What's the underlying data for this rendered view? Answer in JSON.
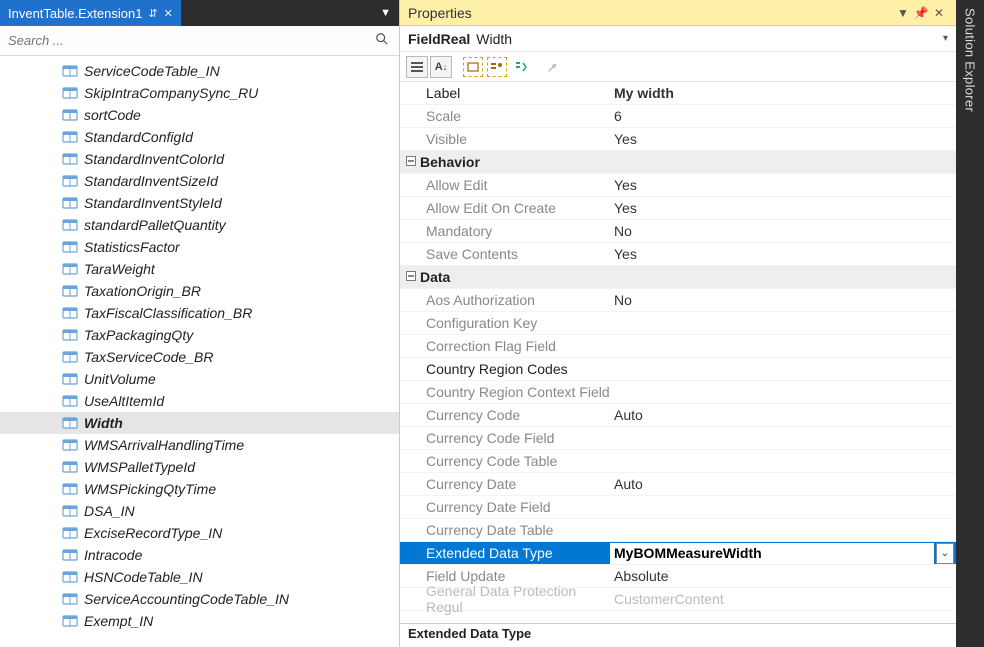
{
  "tab": {
    "title": "InventTable.Extension1",
    "pinned_glyph": "⇵",
    "close_glyph": "✕",
    "menu_glyph": "▼"
  },
  "search": {
    "placeholder": "Search ...",
    "icon_glyph": "🔍"
  },
  "solution_explorer": {
    "label": "Solution Explorer"
  },
  "tree": {
    "selected_index": 16,
    "items": [
      {
        "label": "ServiceCodeTable_IN",
        "style": "it"
      },
      {
        "label": "SkipIntraCompanySync_RU",
        "style": "it"
      },
      {
        "label": "sortCode",
        "style": "it"
      },
      {
        "label": "StandardConfigId",
        "style": "it"
      },
      {
        "label": "StandardInventColorId",
        "style": "it"
      },
      {
        "label": "StandardInventSizeId",
        "style": "it"
      },
      {
        "label": "StandardInventStyleId",
        "style": "it"
      },
      {
        "label": "standardPalletQuantity",
        "style": "it"
      },
      {
        "label": "StatisticsFactor",
        "style": "it"
      },
      {
        "label": "TaraWeight",
        "style": "it"
      },
      {
        "label": "TaxationOrigin_BR",
        "style": "it"
      },
      {
        "label": "TaxFiscalClassification_BR",
        "style": "it"
      },
      {
        "label": "TaxPackagingQty",
        "style": "it"
      },
      {
        "label": "TaxServiceCode_BR",
        "style": "it"
      },
      {
        "label": "UnitVolume",
        "style": "it"
      },
      {
        "label": "UseAltItemId",
        "style": "it"
      },
      {
        "label": "Width",
        "style": "boldit"
      },
      {
        "label": "WMSArrivalHandlingTime",
        "style": "it"
      },
      {
        "label": "WMSPalletTypeId",
        "style": "it"
      },
      {
        "label": "WMSPickingQtyTime",
        "style": "it"
      },
      {
        "label": "DSA_IN",
        "style": "it"
      },
      {
        "label": "ExciseRecordType_IN",
        "style": "it"
      },
      {
        "label": "Intracode",
        "style": "it"
      },
      {
        "label": "HSNCodeTable_IN",
        "style": "it"
      },
      {
        "label": "ServiceAccountingCodeTable_IN",
        "style": "it"
      },
      {
        "label": "Exempt_IN",
        "style": "it"
      }
    ]
  },
  "props": {
    "panel_title": "Properties",
    "object_type": "FieldReal",
    "object_name": "Width",
    "toolbar": {
      "categorized": "▤",
      "alpha": "A↓",
      "prop_pages": "▭+",
      "grouped": "≣•",
      "events": "E↓",
      "wrench": "🔧"
    },
    "description": "Extended Data Type",
    "rows": [
      {
        "kind": "prop",
        "name": "Label",
        "value": "My width",
        "dark": true,
        "bold": true
      },
      {
        "kind": "prop",
        "name": "Scale",
        "value": "6"
      },
      {
        "kind": "prop",
        "name": "Visible",
        "value": "Yes"
      },
      {
        "kind": "cat",
        "name": "Behavior"
      },
      {
        "kind": "prop",
        "name": "Allow Edit",
        "value": "Yes"
      },
      {
        "kind": "prop",
        "name": "Allow Edit On Create",
        "value": "Yes"
      },
      {
        "kind": "prop",
        "name": "Mandatory",
        "value": "No"
      },
      {
        "kind": "prop",
        "name": "Save Contents",
        "value": "Yes"
      },
      {
        "kind": "cat",
        "name": "Data"
      },
      {
        "kind": "prop",
        "name": "Aos Authorization",
        "value": "No"
      },
      {
        "kind": "prop",
        "name": "Configuration Key",
        "value": ""
      },
      {
        "kind": "prop",
        "name": "Correction Flag Field",
        "value": ""
      },
      {
        "kind": "prop",
        "name": "Country Region Codes",
        "value": "",
        "dark": true
      },
      {
        "kind": "prop",
        "name": "Country Region Context Field",
        "value": ""
      },
      {
        "kind": "prop",
        "name": "Currency Code",
        "value": "Auto"
      },
      {
        "kind": "prop",
        "name": "Currency Code Field",
        "value": ""
      },
      {
        "kind": "prop",
        "name": "Currency Code Table",
        "value": ""
      },
      {
        "kind": "prop",
        "name": "Currency Date",
        "value": "Auto"
      },
      {
        "kind": "prop",
        "name": "Currency Date Field",
        "value": ""
      },
      {
        "kind": "prop",
        "name": "Currency Date Table",
        "value": ""
      },
      {
        "kind": "prop",
        "name": "Extended Data Type",
        "value": "MyBOMMeasureWidth",
        "selected": true
      },
      {
        "kind": "prop",
        "name": "Field Update",
        "value": "Absolute"
      },
      {
        "kind": "prop",
        "name": "General Data Protection Regul",
        "value": "CustomerContent",
        "cut": true
      }
    ]
  }
}
